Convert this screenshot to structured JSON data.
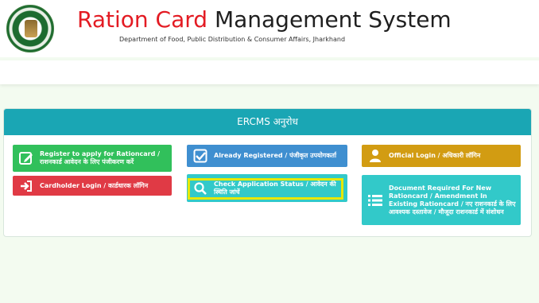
{
  "header": {
    "title_red": "Ration Card",
    "title_rest": " Management System",
    "subtitle": "Department of Food, Public Distribution & Consumer Affairs, Jharkhand"
  },
  "panel": {
    "heading": "ERCMS अनुरोध"
  },
  "buttons": {
    "register": "Register to apply for Rationcard / राशनकार्ड आवेदन के लिए पंजीकरण करें",
    "cardholder_login": "Cardholder Login / कार्डधारक लॉगिन",
    "already_registered": "Already Registered / पंजीकृत उपयोगकर्ता",
    "check_status": "Check Application Status / आवेदन की स्थिति जांचें",
    "official_login": "Official Login / अधिकारी लॉगिन",
    "documents": "Document Required For New Rationcard / Amendment In Existing Rationcard / नए राशनकार्ड के लिए आवश्यक दस्तावेज / मौजूदा राशनकार्ड में संशोधन"
  },
  "colors": {
    "green": "#31c05b",
    "red": "#e03a45",
    "blue": "#3f8fd0",
    "cyan": "#32c9c9",
    "gold": "#d29c12",
    "panel_header": "#1aa6b4",
    "highlight": "#e8e800"
  }
}
